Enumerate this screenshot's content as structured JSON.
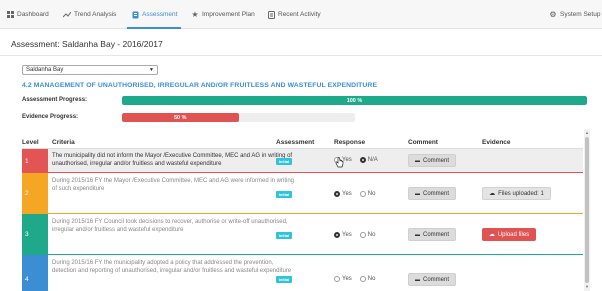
{
  "nav": {
    "items": [
      {
        "label": "Dashboard",
        "icon": "dashboard-icon"
      },
      {
        "label": "Trend Analysis",
        "icon": "trend-icon"
      },
      {
        "label": "Assessment",
        "icon": "assessment-icon"
      },
      {
        "label": "Improvement Plan",
        "icon": "star-icon"
      },
      {
        "label": "Recent Activity",
        "icon": "activity-icon"
      }
    ],
    "active": "Assessment",
    "setup_label": "System Setup"
  },
  "page": {
    "title": "Assessment: Saldanha Bay - 2016/2017",
    "municipality_select": "Saldanha Bay",
    "section_heading": "4.2 MANAGEMENT OF UNAUTHORISED, IRREGULAR AND/OR FRUITLESS AND WASTEFUL EXPENDITURE"
  },
  "progress": {
    "assessment_label": "Assessment Progress:",
    "assessment_text": "100 %",
    "assessment_value": 1.0,
    "evidence_label": "Evidence Progress:",
    "evidence_text": "50 %",
    "evidence_value": 0.5
  },
  "table": {
    "headers": {
      "level": "Level",
      "criteria": "Criteria",
      "assessment": "Assessment",
      "response": "Response",
      "comment": "Comment",
      "evidence": "Evidence"
    },
    "rows": [
      {
        "level": "1",
        "criteria": "The municipality did not inform the Mayor /Executive Committee, MEC and AG in writing of unauthorised, irregular and/or fruitless and wasteful expenditure",
        "badge": "Initial",
        "option_a": "Yes",
        "option_b": "N/A",
        "comment": "Comment",
        "evidence": ""
      },
      {
        "level": "2",
        "criteria": "During 2015/16 FY the Mayor /Executive Committee, MEC and AG were informed in writing of such expenditure",
        "badge": "Initial",
        "option_a": "Yes",
        "option_b": "No",
        "comment": "Comment",
        "evidence": "Files uploaded: 1"
      },
      {
        "level": "3",
        "criteria": "During 2015/16 FY Council took decisions to recover, authorise or write-off unauthorised, irregular and/or fruitless and wasteful expenditure",
        "badge": "Initial",
        "option_a": "Yes",
        "option_b": "No",
        "comment": "Comment",
        "evidence": "Upload files"
      },
      {
        "level": "4",
        "criteria": "During 2015/16 FY the municipality adopted a policy that addressed the prevention, detection and reporting of unauthorised, irregular and/or fruitless and wasteful expenditure",
        "badge": "Initial",
        "option_a": "Yes",
        "option_b": "No",
        "comment": "Comment",
        "evidence": ""
      }
    ]
  },
  "colors": {
    "accent": "#3b8ed4",
    "assessment_bar": "#1fa98b",
    "evidence_bar": "#e05353",
    "level1": "#e35454",
    "level2": "#f5a623",
    "level3": "#1fa98b",
    "level4": "#3b8ed4"
  }
}
